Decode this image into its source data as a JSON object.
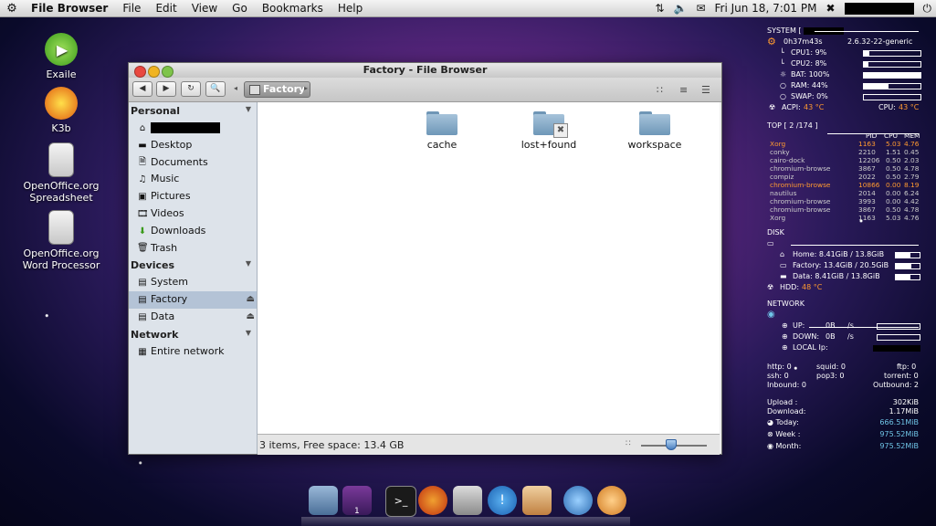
{
  "panel": {
    "app_name": "File Browser",
    "menus": [
      "File",
      "Edit",
      "View",
      "Go",
      "Bookmarks",
      "Help"
    ],
    "datetime": "Fri Jun 18,  7:01 PM"
  },
  "desktop_icons": [
    "Exaile",
    "K3b",
    "OpenOffice.org\nSpreadsheet",
    "OpenOffice.org\nWord Processor"
  ],
  "window": {
    "title": "Factory - File Browser",
    "breadcrumb": "Factory",
    "sidebar": {
      "personal_header": "Personal",
      "personal_items": [
        "Desktop",
        "Documents",
        "Music",
        "Pictures",
        "Videos",
        "Downloads",
        "Trash"
      ],
      "devices_header": "Devices",
      "device_items": [
        "System",
        "Factory",
        "Data"
      ],
      "network_header": "Network",
      "network_items": [
        "Entire network"
      ]
    },
    "folders": [
      "cache",
      "lost+found",
      "workspace"
    ],
    "status": "3 items, Free space: 13.4 GB",
    "zoom_level_fraction": 0.45
  },
  "conky": {
    "system_label": "SYSTEM [",
    "uptime": "0h37m43s",
    "kernel": "2.6.32-22-generic",
    "stats": [
      {
        "label": "CPU1: 9%",
        "fill": 0.09
      },
      {
        "label": "CPU2: 8%",
        "fill": 0.08
      },
      {
        "label": "BAT: 100%",
        "fill": 1.0
      },
      {
        "label": "RAM: 44%",
        "fill": 0.44
      },
      {
        "label": "SWAP: 0%",
        "fill": 0.0
      }
    ],
    "acpi_label": "ACPI:",
    "acpi_value": "43 °C",
    "cpu_temp_label": "CPU:",
    "cpu_temp_value": "43 °C",
    "top_header": "TOP [ 2   /174  ]",
    "top_cols": [
      "PID",
      "CPU",
      "MEM"
    ],
    "top_rows": [
      [
        "Xorg",
        "1163",
        "5.03",
        "4.76"
      ],
      [
        "conky",
        "2210",
        "1.51",
        "0.45"
      ],
      [
        "cairo-dock",
        "12206",
        "0.50",
        "2.03"
      ],
      [
        "chromium-browse",
        "3867",
        "0.50",
        "4.78"
      ],
      [
        "compiz",
        "2022",
        "0.50",
        "2.79"
      ],
      [
        "chromium-browse",
        "10866",
        "0.00",
        "8.19"
      ],
      [
        "nautilus",
        "2014",
        "0.00",
        "6.24"
      ],
      [
        "chromium-browse",
        "3993",
        "0.00",
        "4.42"
      ],
      [
        "chromium-browse",
        "3867",
        "0.50",
        "4.78"
      ],
      [
        "Xorg",
        "1163",
        "5.03",
        "4.76"
      ]
    ],
    "disk_header": "DISK",
    "disks": [
      {
        "label": "Home: 8.41GiB / 13.8GiB",
        "fill": 0.61
      },
      {
        "label": "Factory: 13.4GiB / 20.5GiB",
        "fill": 0.65
      },
      {
        "label": "Data: 8.41GiB / 13.8GiB",
        "fill": 0.61
      }
    ],
    "hdd_label": "HDD:",
    "hdd_value": "48 °C",
    "network_header": "NETWORK",
    "up_label": "UP:",
    "up_value": "0B",
    "down_label": "DOWN:",
    "down_value": "0B",
    "per_s": "/s",
    "local_ip_label": "LOCAL Ip:",
    "conn": {
      "http": "http: 0",
      "squid": "squid:  0",
      "ftp": "ftp: 0",
      "ssh": "ssh: 0",
      "pop3": "pop3: 0",
      "torrent": "torrent: 0",
      "inbound": "Inbound: 0",
      "outbound": "Outbound: 2"
    },
    "upload_label": "Upload :",
    "upload_value": "302KiB",
    "download_label": "Download:",
    "download_value": "1.17MiB",
    "today_label": "Today:",
    "today_value": "666.51MiB",
    "week_label": "Week :",
    "week_value": "975.52MiB",
    "month_label": "Month:",
    "month_value": "975.52MiB"
  },
  "dock_badge": "1"
}
